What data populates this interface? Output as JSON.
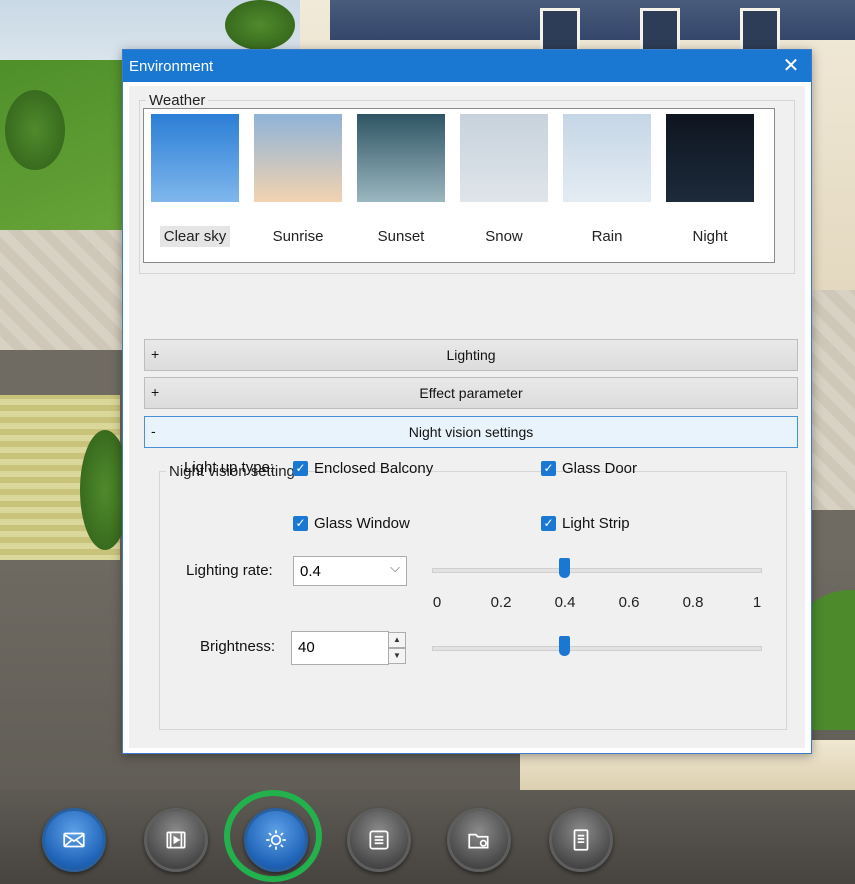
{
  "dialog": {
    "title": "Environment",
    "close_icon": "close-icon"
  },
  "weather": {
    "legend": "Weather",
    "options": [
      {
        "label": "Clear sky",
        "selected": true,
        "colors": [
          "#2b7ed6",
          "#7fb7ec"
        ]
      },
      {
        "label": "Sunrise",
        "selected": false,
        "colors": [
          "#8fb3d8",
          "#f2d3b0"
        ]
      },
      {
        "label": "Sunset",
        "selected": false,
        "colors": [
          "#2f5564",
          "#9bb7c0"
        ]
      },
      {
        "label": "Snow",
        "selected": false,
        "colors": [
          "#c7d2dc",
          "#dfe5ea"
        ]
      },
      {
        "label": "Rain",
        "selected": false,
        "colors": [
          "#c5d6e6",
          "#e4ecf3"
        ]
      },
      {
        "label": "Night",
        "selected": false,
        "colors": [
          "#0e1520",
          "#1d2a3a"
        ]
      }
    ]
  },
  "sections": [
    {
      "sign": "+",
      "label": "Lighting",
      "expanded": false
    },
    {
      "sign": "+",
      "label": "Effect parameter",
      "expanded": false
    },
    {
      "sign": "-",
      "label": "Night vision settings",
      "expanded": true
    }
  ],
  "night_vision": {
    "legend": "Night vision settings",
    "light_up_type_label": "Light up type:",
    "checkboxes": [
      {
        "label": "Enclosed Balcony",
        "checked": true
      },
      {
        "label": "Glass Door",
        "checked": true
      },
      {
        "label": "Glass Window",
        "checked": true
      },
      {
        "label": "Light Strip",
        "checked": true
      }
    ],
    "lighting_rate_label": "Lighting rate:",
    "lighting_rate_value": "0.4",
    "lighting_rate_fraction": 0.4,
    "scale_ticks": [
      "0",
      "0.2",
      "0.4",
      "0.6",
      "0.8",
      "1"
    ],
    "brightness_label": "Brightness:",
    "brightness_value": "40",
    "brightness_fraction": 0.4
  },
  "toolbar": {
    "buttons": [
      {
        "name": "mail-button",
        "icon": "mail-icon",
        "active": true
      },
      {
        "name": "video-button",
        "icon": "film-icon",
        "active": false
      },
      {
        "name": "environment-button",
        "icon": "sun-icon",
        "active": true,
        "highlighted": true
      },
      {
        "name": "list-button",
        "icon": "list-icon",
        "active": false
      },
      {
        "name": "folder-settings-button",
        "icon": "folder-gear-icon",
        "active": false
      },
      {
        "name": "document-button",
        "icon": "document-icon",
        "active": false
      }
    ]
  },
  "colors": {
    "accent": "#1a78d3",
    "highlight_ring": "#22b14c"
  }
}
